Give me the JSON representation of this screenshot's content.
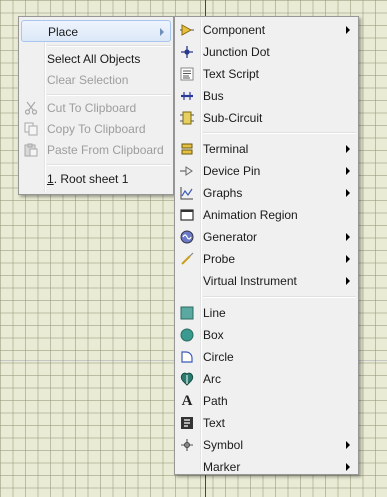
{
  "context_menu": {
    "place_label": "Place",
    "select_all_label": "Select All Objects",
    "clear_selection_label": "Clear Selection",
    "cut_label": "Cut To Clipboard",
    "copy_label": "Copy To Clipboard",
    "paste_label": "Paste From Clipboard",
    "root_sheet_number": "1",
    "root_sheet_label": ". Root sheet 1"
  },
  "place_submenu": {
    "items": [
      {
        "label": "Component",
        "icon": "component-icon",
        "has_submenu": true
      },
      {
        "label": "Junction Dot",
        "icon": "junction-dot-icon",
        "has_submenu": false
      },
      {
        "label": "Text Script",
        "icon": "text-script-icon",
        "has_submenu": false
      },
      {
        "label": "Bus",
        "icon": "bus-icon",
        "has_submenu": false
      },
      {
        "label": "Sub-Circuit",
        "icon": "sub-circuit-icon",
        "has_submenu": false
      },
      {
        "label": "Terminal",
        "icon": "terminal-icon",
        "has_submenu": true
      },
      {
        "label": "Device Pin",
        "icon": "device-pin-icon",
        "has_submenu": true
      },
      {
        "label": "Graphs",
        "icon": "graphs-icon",
        "has_submenu": true
      },
      {
        "label": "Animation Region",
        "icon": "animation-region-icon",
        "has_submenu": false
      },
      {
        "label": "Generator",
        "icon": "generator-icon",
        "has_submenu": true
      },
      {
        "label": "Probe",
        "icon": "probe-icon",
        "has_submenu": true
      },
      {
        "label": "Virtual Instrument",
        "icon": "virtual-instrument-icon",
        "has_submenu": true
      },
      {
        "label": "Line",
        "icon": "line-icon",
        "has_submenu": false
      },
      {
        "label": "Box",
        "icon": "box-icon",
        "has_submenu": false
      },
      {
        "label": "Circle",
        "icon": "circle-icon",
        "has_submenu": false
      },
      {
        "label": "Arc",
        "icon": "arc-icon",
        "has_submenu": false
      },
      {
        "label": "Path",
        "icon": "path-icon",
        "has_submenu": false
      },
      {
        "label": "Text",
        "icon": "text-icon",
        "has_submenu": false
      },
      {
        "label": "Symbol",
        "icon": "symbol-icon",
        "has_submenu": true
      },
      {
        "label": "Marker",
        "icon": "marker-icon",
        "has_submenu": true
      }
    ]
  },
  "colors": {
    "canvas": "#e9ebd4",
    "menu_background": "#f0f0f0",
    "highlight": "#dce8f8",
    "disabled_text": "#9d9d9d"
  }
}
